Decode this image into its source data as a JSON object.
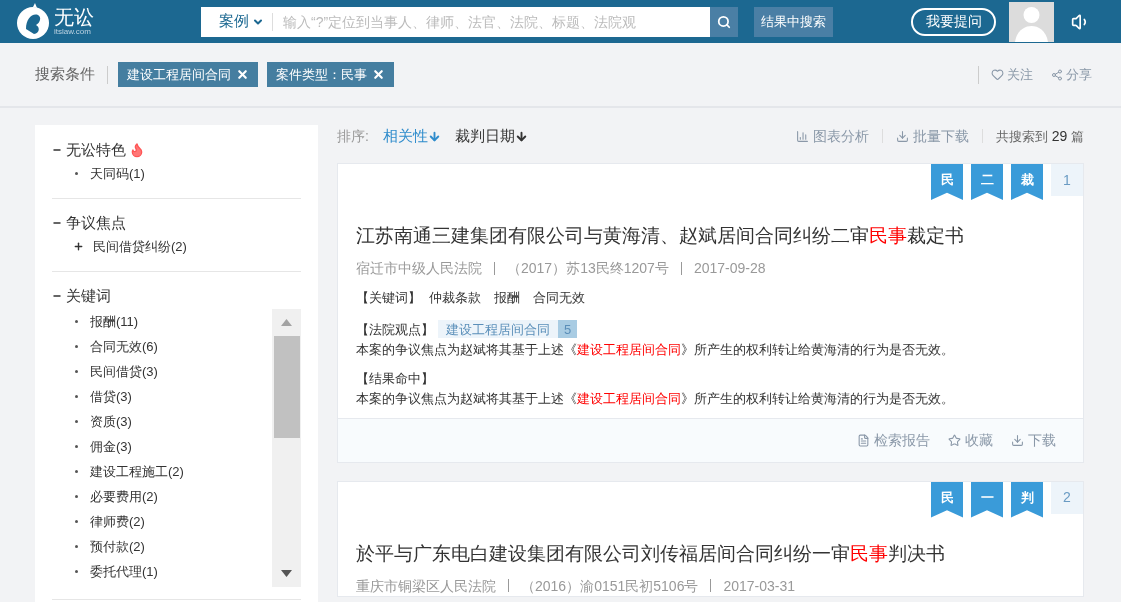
{
  "header": {
    "logo": {
      "name": "无讼",
      "domain": "itslaw.com"
    },
    "search": {
      "scope": "案例",
      "placeholder": "输入“?”定位到当事人、律师、法官、法院、标题、法院观"
    },
    "refine_button": "结果中搜索",
    "ask_button": "我要提问"
  },
  "conditions": {
    "label": "搜索条件",
    "tags": [
      "建设工程居间合同",
      "案件类型：民事"
    ],
    "follow": "关注",
    "share": "分享"
  },
  "sidebar": {
    "sections": [
      {
        "title": "无讼特色",
        "hot": true,
        "expanded": true,
        "scroll": false,
        "items": [
          {
            "kind": "bullet",
            "label": "天同码(1)"
          }
        ]
      },
      {
        "title": "争议焦点",
        "hot": false,
        "expanded": true,
        "scroll": false,
        "items": [
          {
            "kind": "plus",
            "label": "民间借贷纠纷(2)"
          }
        ]
      },
      {
        "title": "关键词",
        "hot": false,
        "expanded": true,
        "scroll": true,
        "items": [
          {
            "kind": "bullet",
            "label": "报酬(11)"
          },
          {
            "kind": "bullet",
            "label": "合同无效(6)"
          },
          {
            "kind": "bullet",
            "label": "民间借贷(3)"
          },
          {
            "kind": "bullet",
            "label": "借贷(3)"
          },
          {
            "kind": "bullet",
            "label": "资质(3)"
          },
          {
            "kind": "bullet",
            "label": "佣金(3)"
          },
          {
            "kind": "bullet",
            "label": "建设工程施工(2)"
          },
          {
            "kind": "bullet",
            "label": "必要费用(2)"
          },
          {
            "kind": "bullet",
            "label": "律师费(2)"
          },
          {
            "kind": "bullet",
            "label": "预付款(2)"
          },
          {
            "kind": "bullet",
            "label": "委托代理(1)"
          }
        ]
      }
    ]
  },
  "sort": {
    "label": "排序:",
    "options": [
      {
        "label": "相关性",
        "selected": true
      },
      {
        "label": "裁判日期",
        "selected": false
      }
    ],
    "chart": "图表分析",
    "download": "批量下载",
    "count": {
      "prefix": "共搜索到",
      "number": "29",
      "suffix": "篇"
    }
  },
  "results": [
    {
      "badges": [
        "民",
        "二",
        "裁"
      ],
      "index": "1",
      "title": [
        {
          "text": "江苏南通三建集团有限公司与黄海清、赵斌居间合同纠纷二审",
          "highlight": false
        },
        {
          "text": "民事",
          "highlight": true
        },
        {
          "text": "裁定书",
          "highlight": false
        }
      ],
      "court": "宿迁市中级人民法院",
      "case_no": "（2017）苏13民终1207号",
      "date": "2017-09-28",
      "keywords_label": "【关键词】",
      "keywords": [
        "仲裁条款",
        "报酬",
        "合同无效"
      ],
      "opinion_label": "【法院观点】",
      "opinion_tag": "建设工程居间合同",
      "opinion_count": "5",
      "opinion": [
        {
          "text": "本案的争议焦点为赵斌将其基于上述《",
          "highlight": false
        },
        {
          "text": "建设工程居间合同",
          "highlight": true
        },
        {
          "text": "》所产生的权利转让给黄海清的行为是否无效。",
          "highlight": false
        }
      ],
      "hit_label": "【结果命中】",
      "hit": [
        {
          "text": "本案的争议焦点为赵斌将其基于上述《",
          "highlight": false
        },
        {
          "text": "建设工程居间合同",
          "highlight": true
        },
        {
          "text": "》所产生的权利转让给黄海清的行为是否无效。",
          "highlight": false
        }
      ],
      "actions": [
        {
          "kind": "report",
          "label": "检索报告"
        },
        {
          "kind": "star",
          "label": "收藏"
        },
        {
          "kind": "download",
          "label": "下载"
        }
      ]
    },
    {
      "badges": [
        "民",
        "一",
        "判"
      ],
      "index": "2",
      "title": [
        {
          "text": "於平与广东电白建设集团有限公司刘传福居间合同纠纷一审",
          "highlight": false
        },
        {
          "text": "民事",
          "highlight": true
        },
        {
          "text": "判决书",
          "highlight": false
        }
      ],
      "court": "重庆市铜梁区人民法院",
      "case_no": "（2016）渝0151民初5106号",
      "date": "2017-03-31"
    }
  ]
}
